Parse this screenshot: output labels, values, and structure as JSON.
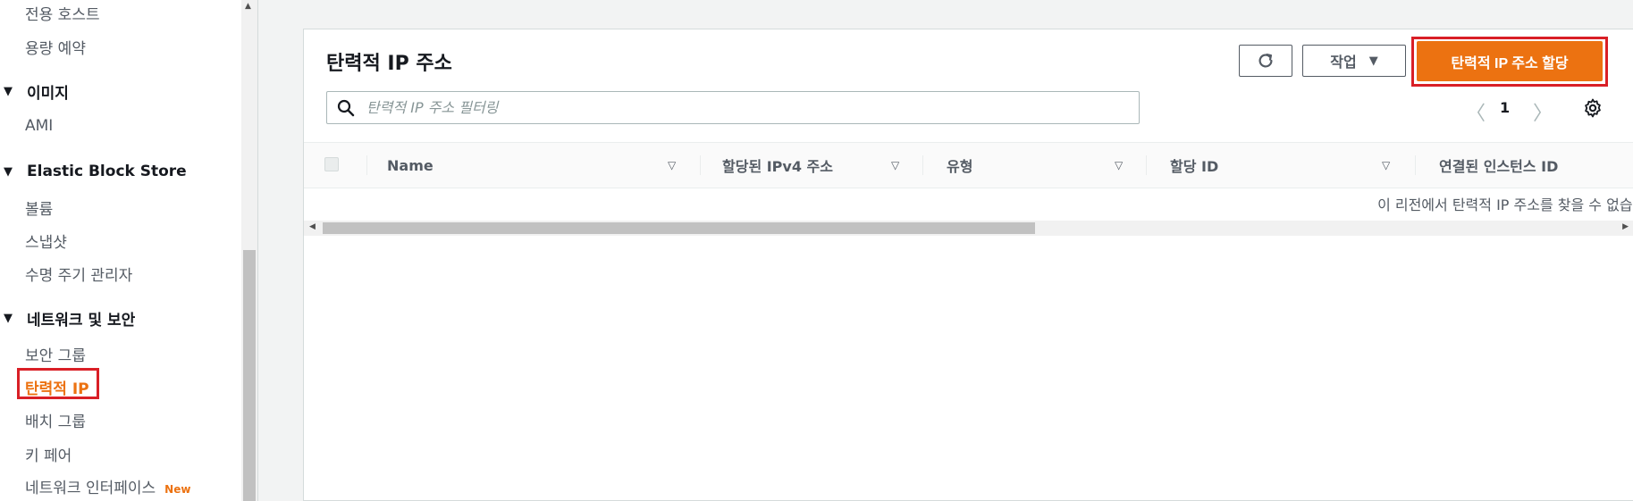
{
  "sidebar": {
    "items_top": [
      "전용 호스트",
      "용량 예약"
    ],
    "sections": [
      {
        "title": "이미지",
        "items": [
          "AMI"
        ]
      },
      {
        "title": "Elastic Block Store",
        "items": [
          "볼륨",
          "스냅샷",
          "수명 주기 관리자"
        ]
      },
      {
        "title": "네트워크 및 보안",
        "items": [
          "보안 그룹",
          "탄력적 IP",
          "배치 그룹",
          "키 페어",
          "네트워크 인터페이스"
        ]
      }
    ],
    "new_badge": "New",
    "active_item": "탄력적 IP"
  },
  "panel": {
    "title": "탄력적 IP 주소",
    "actions_label": "작업",
    "primary_button": "탄력적 IP 주소 할당",
    "search_placeholder": "탄력적 IP 주소 필터링",
    "page_number": "1"
  },
  "table": {
    "columns": [
      "Name",
      "할당된 IPv4 주소",
      "유형",
      "할당 ID",
      "연결된 인스턴스 ID"
    ],
    "empty_message": "이 리전에서 탄력적 IP 주소를 찾을 수 없습니다"
  },
  "colors": {
    "accent": "#ec7211",
    "highlight_border": "#d91f26"
  }
}
